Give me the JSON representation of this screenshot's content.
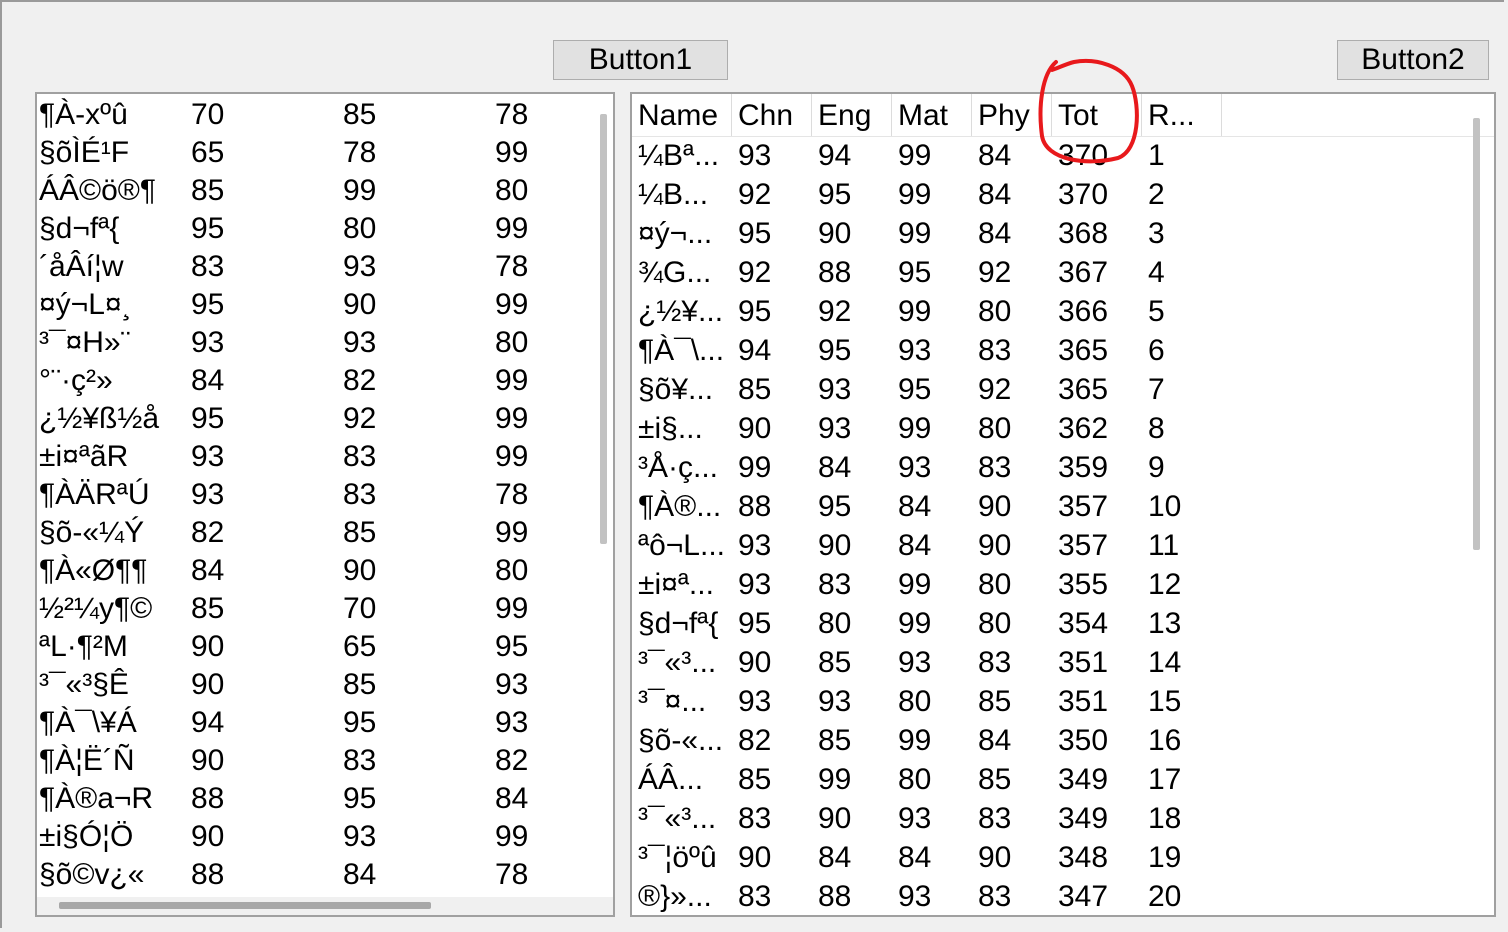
{
  "buttons": {
    "button1": "Button1",
    "button2": "Button2"
  },
  "left_list": {
    "rows": [
      [
        "¶À-xºû",
        "70",
        "85",
        "78"
      ],
      [
        "§õÌÉ¹F",
        "65",
        "78",
        "99"
      ],
      [
        "ÁÂ©ö®¶",
        "85",
        "99",
        "80"
      ],
      [
        "§d¬fª{",
        "95",
        "80",
        "99"
      ],
      [
        "´åÂí¦w",
        "83",
        "93",
        "78"
      ],
      [
        "¤ý¬L¤¸",
        "95",
        "90",
        "99"
      ],
      [
        "³¯¤H»¨",
        "93",
        "93",
        "80"
      ],
      [
        "°¨·ç²»",
        "84",
        "82",
        "99"
      ],
      [
        "¿½¥ß½å",
        "95",
        "92",
        "99"
      ],
      [
        "±i¤ªãR",
        "93",
        "83",
        "99"
      ],
      [
        "¶ÀÄRªÚ",
        "93",
        "83",
        "78"
      ],
      [
        "§õ-«¼Ý",
        "82",
        "85",
        "99"
      ],
      [
        "¶À«Ø¶¶",
        "84",
        "90",
        "80"
      ],
      [
        "½²¼y¶©",
        "85",
        "70",
        "99"
      ],
      [
        "ªL·¶²M",
        "90",
        "65",
        "95"
      ],
      [
        "³¯«³§Ê",
        "90",
        "85",
        "93"
      ],
      [
        "¶À¯\\¥Á",
        "94",
        "95",
        "93"
      ],
      [
        "¶À¦Ë´Ñ",
        "90",
        "83",
        "82"
      ],
      [
        "¶À®a¬R",
        "88",
        "95",
        "84"
      ],
      [
        "±i§Ó¦Ö",
        "90",
        "93",
        "99"
      ],
      [
        "§õ©v¿«",
        "88",
        "84",
        "78"
      ]
    ]
  },
  "right_list": {
    "columns": [
      "Name",
      "Chn",
      "Eng",
      "Mat",
      "Phy",
      "Tot",
      "R..."
    ],
    "rows": [
      [
        "¼Bª...",
        "93",
        "94",
        "99",
        "84",
        "370",
        "1"
      ],
      [
        "¼B...",
        "92",
        "95",
        "99",
        "84",
        "370",
        "2"
      ],
      [
        "¤ý¬...",
        "95",
        "90",
        "99",
        "84",
        "368",
        "3"
      ],
      [
        "¾G...",
        "92",
        "88",
        "95",
        "92",
        "367",
        "4"
      ],
      [
        "¿½¥...",
        "95",
        "92",
        "99",
        "80",
        "366",
        "5"
      ],
      [
        "¶À¯\\...",
        "94",
        "95",
        "93",
        "83",
        "365",
        "6"
      ],
      [
        "§õ¥...",
        "85",
        "93",
        "95",
        "92",
        "365",
        "7"
      ],
      [
        "±i§...",
        "90",
        "93",
        "99",
        "80",
        "362",
        "8"
      ],
      [
        "³Å·ç...",
        "99",
        "84",
        "93",
        "83",
        "359",
        "9"
      ],
      [
        "¶À®...",
        "88",
        "95",
        "84",
        "90",
        "357",
        "10"
      ],
      [
        "ªô¬L...",
        "93",
        "90",
        "84",
        "90",
        "357",
        "11"
      ],
      [
        "±i¤ª...",
        "93",
        "83",
        "99",
        "80",
        "355",
        "12"
      ],
      [
        "§d¬fª{",
        "95",
        "80",
        "99",
        "80",
        "354",
        "13"
      ],
      [
        "³¯«³...",
        "90",
        "85",
        "93",
        "83",
        "351",
        "14"
      ],
      [
        "³¯¤...",
        "93",
        "93",
        "80",
        "85",
        "351",
        "15"
      ],
      [
        "§õ-«...",
        "82",
        "85",
        "99",
        "84",
        "350",
        "16"
      ],
      [
        "ÁÂ...",
        "85",
        "99",
        "80",
        "85",
        "349",
        "17"
      ],
      [
        "³¯«³...",
        "83",
        "90",
        "93",
        "83",
        "349",
        "18"
      ],
      [
        "³¯¦öºû",
        "90",
        "84",
        "84",
        "90",
        "348",
        "19"
      ],
      [
        "®}»...",
        "83",
        "88",
        "93",
        "83",
        "347",
        "20"
      ]
    ]
  },
  "annotation_color": "#e8191c",
  "icons": [
    "red-circle-annotation-icon"
  ]
}
